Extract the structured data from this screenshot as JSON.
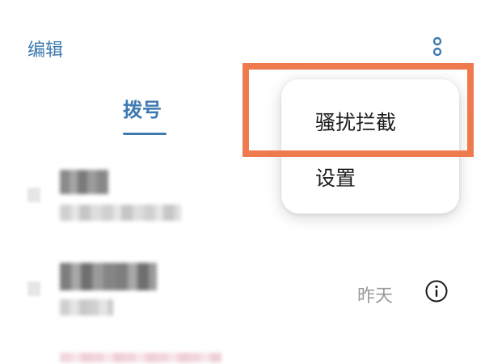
{
  "header": {
    "edit_label": "编辑",
    "more_icon": "more-vertical-icon"
  },
  "tabs": [
    {
      "label": "拨号",
      "active": true
    }
  ],
  "call_list": {
    "rows": [
      {
        "name": "",
        "number": "",
        "time": ""
      },
      {
        "name": "",
        "number": "",
        "time": "昨天",
        "info_icon": "info-icon"
      }
    ]
  },
  "popup_menu": {
    "items": [
      {
        "label": "骚扰拦截",
        "highlighted": true
      },
      {
        "label": "设置"
      }
    ]
  },
  "colors": {
    "accent": "#3d7ab0",
    "highlight": "#ee7a4e",
    "menu_text": "#1a1a1a",
    "muted_text": "#9a9a9a"
  }
}
